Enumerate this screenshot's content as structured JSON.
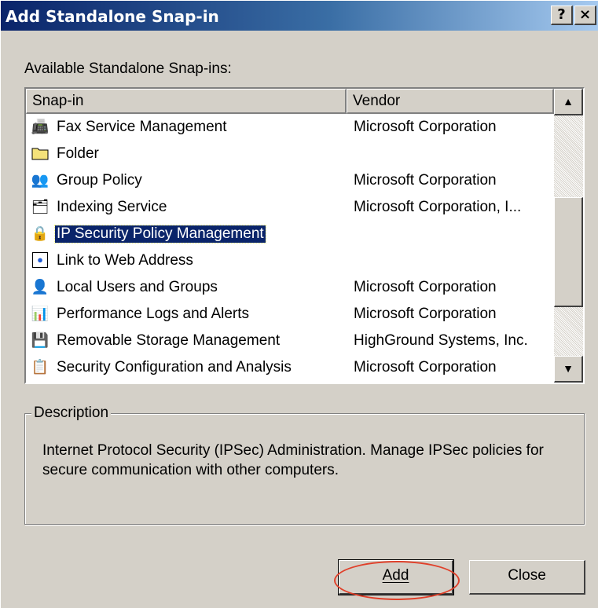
{
  "window": {
    "title": "Add Standalone Snap-in",
    "help_button": "?",
    "close_button": "×"
  },
  "available_label": "Available Standalone Snap-ins:",
  "list": {
    "columns": [
      "Snap-in",
      "Vendor"
    ],
    "rows": [
      {
        "name": "Fax Service Management",
        "vendor": "Microsoft Corporation",
        "icon": "fax-icon",
        "glyph": "📠"
      },
      {
        "name": "Folder",
        "vendor": "",
        "icon": "folder-icon",
        "glyph": ""
      },
      {
        "name": "Group Policy",
        "vendor": "Microsoft Corporation",
        "icon": "group-policy-icon",
        "glyph": "👥"
      },
      {
        "name": "Indexing Service",
        "vendor": "Microsoft Corporation, I...",
        "icon": "indexing-icon",
        "glyph": "🗂"
      },
      {
        "name": "IP Security Policy Management",
        "vendor": "",
        "icon": "ip-security-icon",
        "glyph": "🔒",
        "selected": true
      },
      {
        "name": "Link to Web Address",
        "vendor": "",
        "icon": "web-link-icon",
        "glyph": "◙"
      },
      {
        "name": "Local Users and Groups",
        "vendor": "Microsoft Corporation",
        "icon": "users-icon",
        "glyph": "👤"
      },
      {
        "name": "Performance Logs and Alerts",
        "vendor": "Microsoft Corporation",
        "icon": "performance-icon",
        "glyph": "📊"
      },
      {
        "name": "Removable Storage Management",
        "vendor": "HighGround Systems, Inc.",
        "icon": "removable-storage-icon",
        "glyph": "💾"
      },
      {
        "name": "Security Configuration and Analysis",
        "vendor": "Microsoft Corporation",
        "icon": "security-config-icon",
        "glyph": "📋"
      }
    ],
    "scroll_up_glyph": "▲",
    "scroll_down_glyph": "▼"
  },
  "description": {
    "title": "Description",
    "text": "Internet Protocol Security (IPSec) Administration. Manage IPSec policies for secure communication with other computers."
  },
  "buttons": {
    "add": "Add",
    "close": "Close"
  },
  "colors": {
    "selection": "#0a246a",
    "annotation": "#e0402a"
  }
}
